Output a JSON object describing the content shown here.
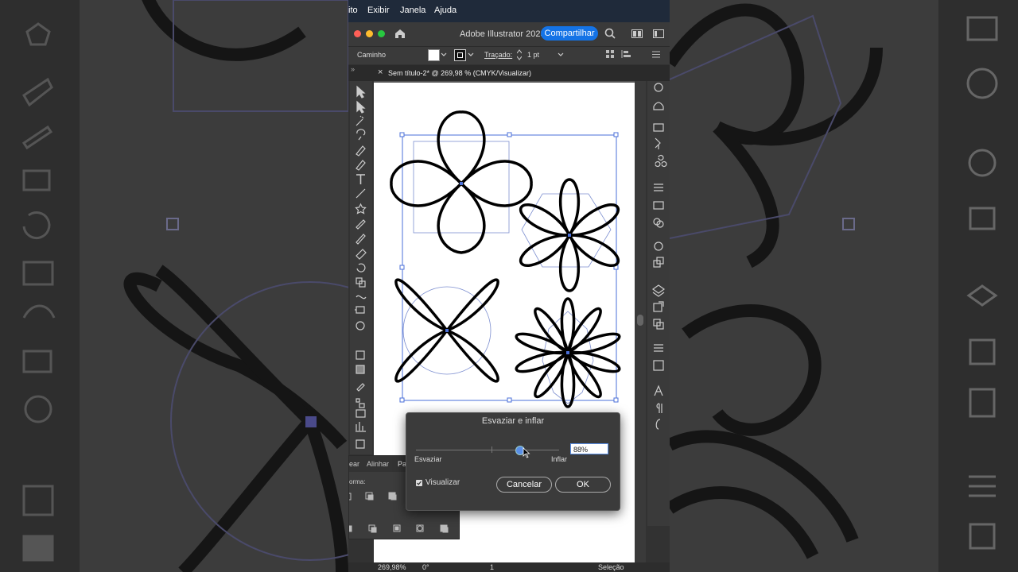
{
  "menu": {
    "items": [
      "ito",
      "Exibir",
      "Janela",
      "Ajuda"
    ]
  },
  "titlebar": {
    "app_title": "Adobe Illustrator 2023",
    "share_label": "Compartilhar"
  },
  "control_bar": {
    "object_type": "Caminho",
    "stroke_label": "Traçado:",
    "stroke_weight": "1 pt"
  },
  "document_tab": {
    "close": "×",
    "title": "Sem título-2* @ 269,98 % (CMYK/Visualizar)"
  },
  "panel": {
    "tabs": [
      "ear",
      "Alinhar",
      "Pa"
    ],
    "label_forma": "orma:"
  },
  "dialog": {
    "title": "Esvaziar e inflar",
    "left_label": "Esvaziar",
    "right_label": "Inflar",
    "value": "88%",
    "slider_fraction": 0.72,
    "preview_label": "Visualizar",
    "preview_checked": true,
    "cancel_label": "Cancelar",
    "ok_label": "OK"
  },
  "status": {
    "zoom": "269,98%",
    "rotation": "0°",
    "artboard": "1",
    "tool": "Seleção"
  },
  "colors": {
    "share_button": "#1473e6",
    "close_dot": "#ff5f57",
    "min_dot": "#febc2e",
    "max_dot": "#28c840",
    "selection": "#4a6fd8"
  }
}
